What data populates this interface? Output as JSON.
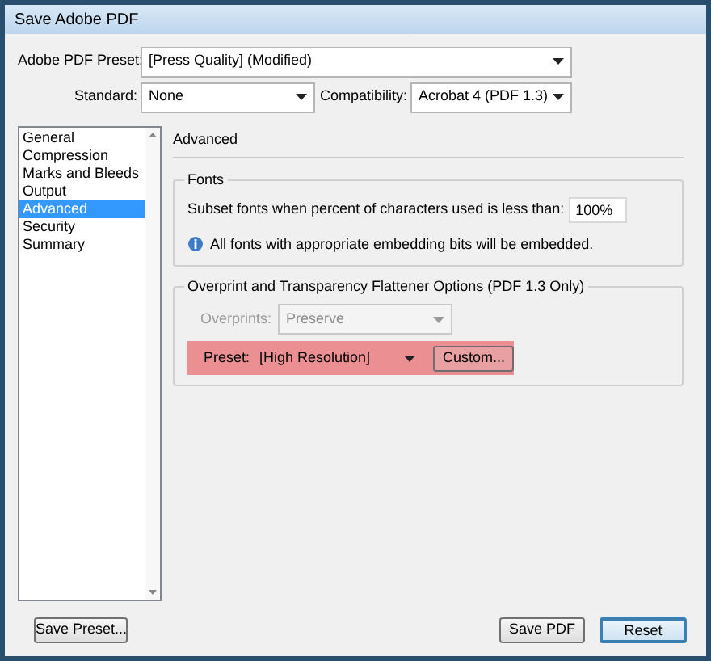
{
  "window": {
    "title": "Save Adobe PDF"
  },
  "preset": {
    "label": "Adobe PDF Preset:",
    "value": "[Press Quality] (Modified)"
  },
  "standard": {
    "label": "Standard:",
    "value": "None"
  },
  "compatibility": {
    "label": "Compatibility:",
    "value": "Acrobat 4 (PDF 1.3)"
  },
  "sidebar": {
    "items": [
      {
        "label": "General",
        "selected": false
      },
      {
        "label": "Compression",
        "selected": false
      },
      {
        "label": "Marks and Bleeds",
        "selected": false
      },
      {
        "label": "Output",
        "selected": false
      },
      {
        "label": "Advanced",
        "selected": true
      },
      {
        "label": "Security",
        "selected": false
      },
      {
        "label": "Summary",
        "selected": false
      }
    ]
  },
  "panel": {
    "title": "Advanced",
    "fonts": {
      "title": "Fonts",
      "subset_label": "Subset fonts when percent of characters used is less than:",
      "subset_value": "100%",
      "info": "All fonts with appropriate embedding bits will be embedded."
    },
    "flattener": {
      "title": "Overprint and Transparency Flattener Options (PDF 1.3 Only)",
      "overprints": {
        "label": "Overprints:",
        "value": "Preserve",
        "disabled": true
      },
      "preset": {
        "label": "Preset:",
        "value": "[High Resolution]",
        "highlighted": true
      },
      "custom_button": "Custom..."
    }
  },
  "buttons": {
    "save_preset": "Save Preset...",
    "save_pdf": "Save PDF",
    "reset": {
      "label": "Reset",
      "default": true
    }
  }
}
